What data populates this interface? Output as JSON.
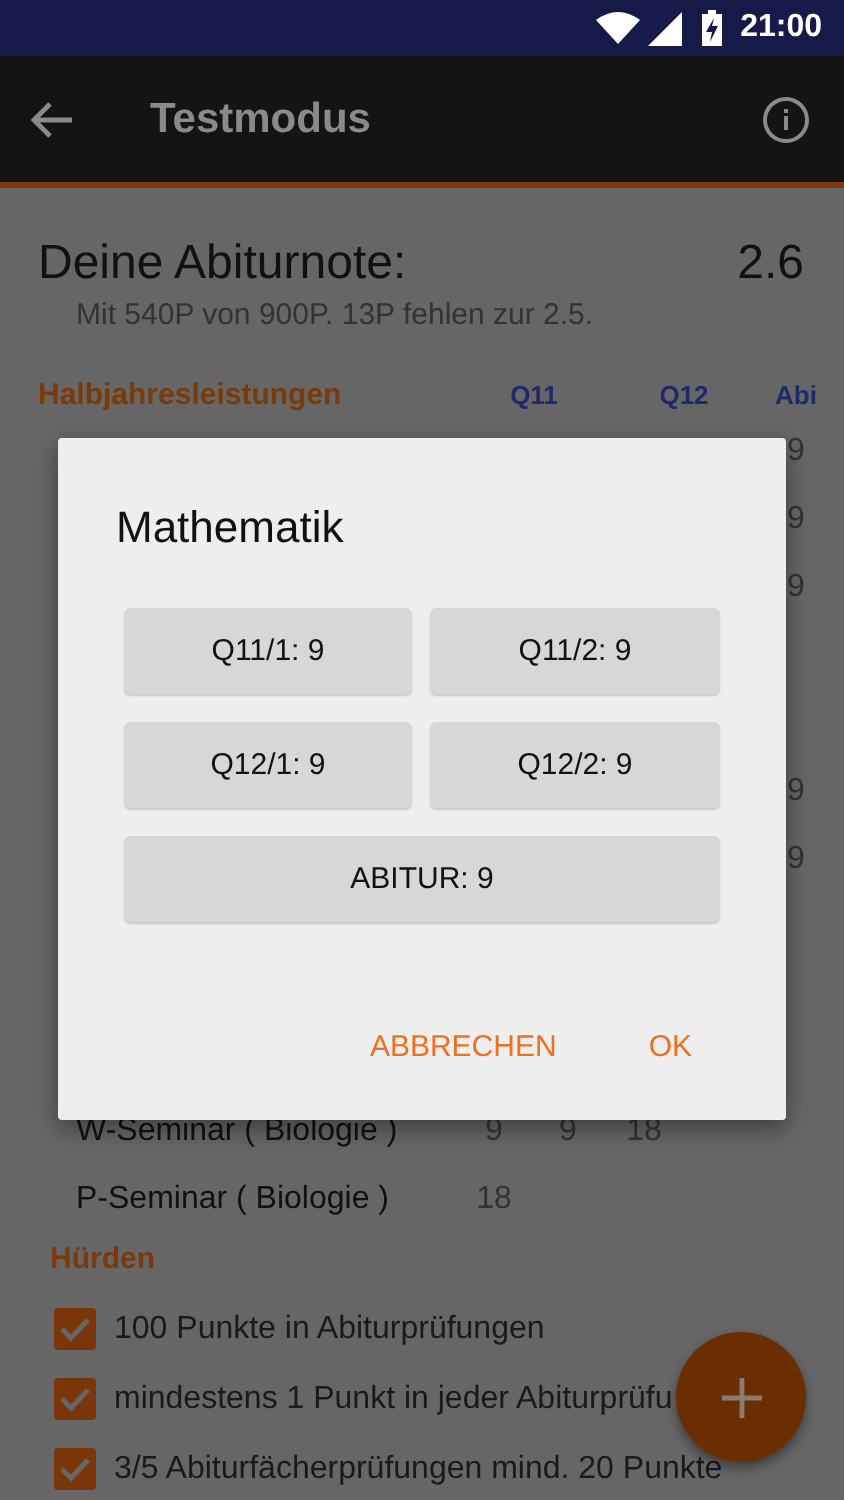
{
  "status_bar": {
    "time": "21:00"
  },
  "app_bar": {
    "title": "Testmodus"
  },
  "summary": {
    "label": "Deine Abiturnote:",
    "grade": "2.6",
    "detail": "Mit 540P von 900P. 13P fehlen zur 2.5."
  },
  "section": {
    "title": "Halbjahresleistungen",
    "columns": [
      "Q11",
      "Q12",
      "Abi"
    ]
  },
  "hidden_rows": [
    {
      "abi": "9"
    },
    {
      "abi": "9"
    },
    {
      "abi": "9"
    },
    {},
    {},
    {
      "abi": "9"
    },
    {
      "abi": "9"
    },
    {},
    {},
    {}
  ],
  "seminars": [
    {
      "name": "W-Seminar ( Biologie )",
      "values": [
        "9",
        "9",
        "18"
      ]
    },
    {
      "name": "P-Seminar ( Biologie )",
      "values": [
        "18"
      ]
    }
  ],
  "hurdles": {
    "title": "Hürden",
    "items": [
      {
        "label": "100 Punkte in Abiturprüfungen",
        "checked": true
      },
      {
        "label": "mindestens 1 Punkt in jeder Abiturprüfu",
        "checked": true
      },
      {
        "label": "3/5 Abiturfächerprüfungen mind. 20 Punkte",
        "checked": true
      }
    ]
  },
  "dialog": {
    "title": "Mathematik",
    "grades": [
      "Q11/1: 9",
      "Q11/2: 9",
      "Q12/1: 9",
      "Q12/2: 9"
    ],
    "final": "ABITUR: 9",
    "actions": [
      "ABBRECHEN",
      "OK"
    ]
  }
}
